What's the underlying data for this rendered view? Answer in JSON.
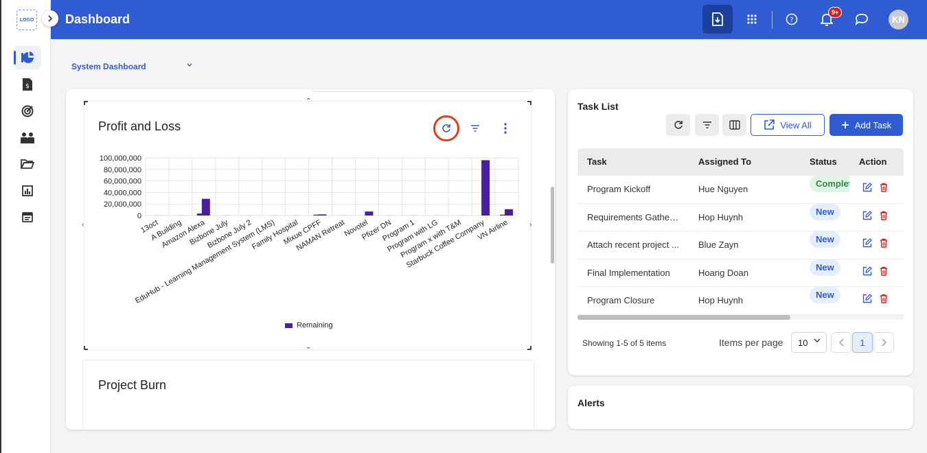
{
  "app": {
    "logo_text": "LOGO",
    "page_title": "Dashboard",
    "notification_badge": "9+",
    "user_initials": "KN"
  },
  "colors": {
    "brand": "#2f5bd3",
    "chart_bar": "#4b1fa3",
    "highlight_ring": "#e23b1a"
  },
  "sidebar": {
    "items": [
      {
        "icon": "pie-chart-icon",
        "active": true
      },
      {
        "icon": "invoice-icon",
        "active": false
      },
      {
        "icon": "target-icon",
        "active": false
      },
      {
        "icon": "team-icon",
        "active": false
      },
      {
        "icon": "folder-icon",
        "active": false
      },
      {
        "icon": "bar-chart-icon",
        "active": false
      },
      {
        "icon": "calendar-icon",
        "active": false
      }
    ]
  },
  "dashboard_selector": {
    "value": "System Dashboard"
  },
  "profit_loss": {
    "title": "Profit and Loss",
    "legend": "Remaining"
  },
  "chart_data": {
    "type": "bar",
    "title": "Profit and Loss",
    "xlabel": "",
    "ylabel": "",
    "ylim": [
      0,
      100000000
    ],
    "y_ticks": [
      "100,000,000",
      "80,000,000",
      "60,000,000",
      "40,000,000",
      "20,000,000",
      "0"
    ],
    "grid": true,
    "legend_position": "bottom",
    "categories": [
      "13oct",
      "A Building",
      "Amazon Alexa",
      "Bizbone July",
      "Bizbone July 2",
      "EduHub - Learning Management System (LMS)",
      "Family Hospital",
      "Mixue CPFF",
      "NAMAN Retreat",
      "Novotel",
      "Pfizer DN",
      "Program 1",
      "Program with LG",
      "Program x with T&M",
      "Starbuck Coffee Company",
      "VN Airline"
    ],
    "tick_labels": [
      "13oct",
      "A Building",
      "Amazon Alexa",
      "Bizbone July",
      "Bizbone July 2",
      "EduHub - Learning Management System (LMS)",
      "Family Hospital",
      "Mixue CPFF",
      "NAMAN Retreat",
      "Novotel",
      "Pfizer DN",
      "Program 1",
      "Program with LG",
      "Program x with T&M",
      "Starbuck Coffee Company",
      "VN Airline"
    ],
    "series": [
      {
        "name": "Remaining",
        "values": [
          0,
          0,
          29000000,
          0,
          0,
          0,
          0,
          2000000,
          0,
          7000000,
          0,
          0,
          0,
          0,
          96000000,
          11000000
        ]
      }
    ],
    "small_bars": [
      {
        "category_index": 2,
        "value": 3500000
      },
      {
        "category_index": 7,
        "value": 1500000
      },
      {
        "category_index": 15,
        "value": 1500000
      }
    ]
  },
  "project_burn": {
    "title": "Project Burn"
  },
  "task_list": {
    "title": "Task List",
    "view_all_label": "View All",
    "add_task_label": "Add Task",
    "columns": [
      "Task",
      "Assigned To",
      "Status",
      "Action"
    ],
    "rows": [
      {
        "task": "Program Kickoff",
        "assigned": "Hue Nguyen",
        "status": "Complet",
        "status_type": "complete"
      },
      {
        "task": "Requirements Gatheri...",
        "assigned": "Hop Huynh",
        "status": "New",
        "status_type": "new"
      },
      {
        "task": "Attach recent project ...",
        "assigned": "Blue Zayn",
        "status": "New",
        "status_type": "new"
      },
      {
        "task": "Final Implementation",
        "assigned": "Hoang Doan",
        "status": "New",
        "status_type": "new"
      },
      {
        "task": "Program Closure",
        "assigned": "Hop Huynh",
        "status": "New",
        "status_type": "new"
      }
    ],
    "showing_text": "Showing 1-5 of 5 items",
    "items_per_page_label": "Items per page",
    "items_per_page_value": "10",
    "current_page": "1"
  },
  "alerts": {
    "title": "Alerts"
  }
}
